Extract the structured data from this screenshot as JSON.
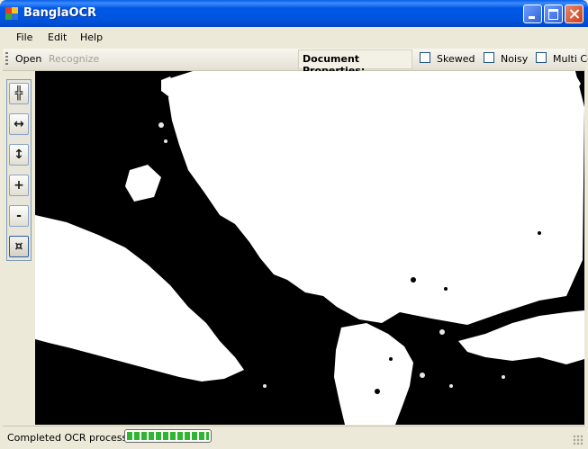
{
  "window": {
    "title": "BanglaOCR"
  },
  "menu": [
    "File",
    "Edit",
    "Help"
  ],
  "toolbar": {
    "open": "Open",
    "recognize": "Recognize",
    "doc_props_label": "Document Properties:",
    "checkboxes": [
      {
        "label": "Skewed",
        "checked": false
      },
      {
        "label": "Noisy",
        "checked": false
      },
      {
        "label": "Multi Co",
        "checked": false
      }
    ]
  },
  "sidebar": {
    "buttons": [
      {
        "symbol": "╬",
        "icon": "fit-both-icon"
      },
      {
        "symbol": "↔",
        "icon": "fit-width-icon"
      },
      {
        "symbol": "↕",
        "icon": "fit-height-icon"
      },
      {
        "symbol": "+",
        "icon": "zoom-in-icon"
      },
      {
        "symbol": "-",
        "icon": "zoom-out-icon"
      },
      {
        "symbol": "¤",
        "icon": "select-region-icon"
      }
    ]
  },
  "status": {
    "text": "Completed OCR process..",
    "progress": 1.0
  },
  "colors": {
    "title_bar": "#0058E6",
    "progress": "#2FB52F",
    "canvas_bg": "#000000"
  }
}
